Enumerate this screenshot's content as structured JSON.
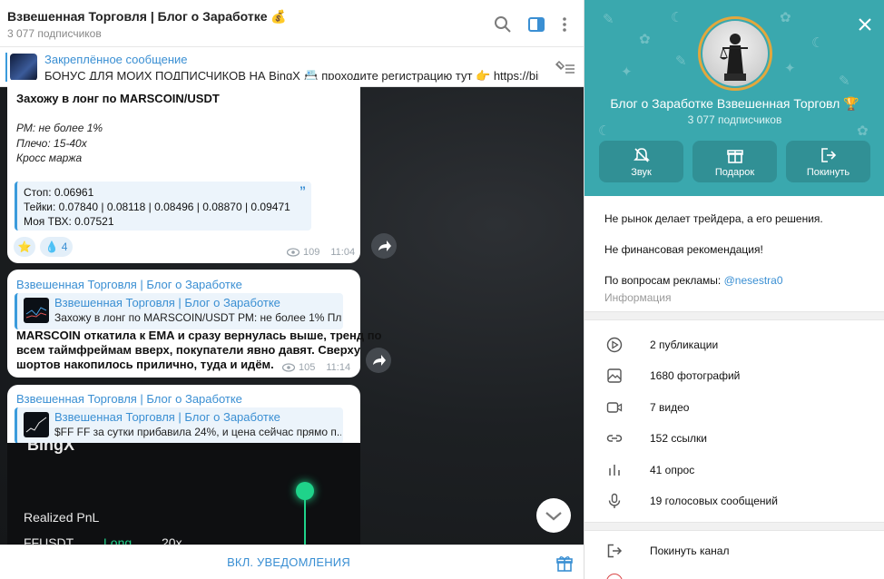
{
  "chat": {
    "title": "Взвешенная Торговля | Блог о Заработке",
    "title_emoji": "💰",
    "subscribers": "3 077 подписчиков",
    "pinned": {
      "title": "Закреплённое сообщение",
      "text": "БОНУС ДЛЯ МОИХ ПОДПИСЧИКОВ НА BingX 📇 проходите регистрацию тут 👉 https://bingx..."
    },
    "messages": [
      {
        "headline": "Захожу в лонг по MARSCOIN/USDT",
        "lines": [
          "РМ: не более 1%",
          "Плечо: 15-40x",
          "Кросс маржа"
        ],
        "quote": [
          "Стоп: 0.06961",
          "Тейки: 0.07840 | 0.08118 | 0.08496 | 0.08870 | 0.09471",
          "Моя ТВХ: 0.07521"
        ],
        "reactions": [
          {
            "emoji": "⭐",
            "count": ""
          },
          {
            "emoji": "💧",
            "count": "4"
          }
        ],
        "views": "109",
        "time": "11:04"
      },
      {
        "sender": "Взвешенная Торговля | Блог о Заработке",
        "fwd_title": "Взвешенная Торговля | Блог о Заработке",
        "fwd_text": "Захожу в лонг по MARSCOIN/USDT  РМ: не более 1% Пле...",
        "body": [
          "MARSCOIN откатила к EMA и сразу вернулась выше, тренд по",
          "всем таймфреймам вверх, покупатели явно давят. Сверху",
          "шортов накопилось прилично, туда и идём."
        ],
        "views": "105",
        "time": "11:14"
      },
      {
        "sender": "Взвешенная Торговля | Блог о Заработке",
        "fwd_title": "Взвешенная Торговля | Блог о Заработке",
        "fwd_text": "$FF  FF за сутки прибавила 24%, и цена сейчас прямо п..."
      }
    ],
    "promo": {
      "logo": "BingX",
      "pnl": "Realized PnL",
      "pair": "FFUSDT",
      "side": "Long",
      "leverage": "20x"
    },
    "footer": {
      "notify": "ВКЛ. УВЕДОМЛЕНИЯ"
    }
  },
  "info": {
    "name": "Блог о Заработке     Взвешенная Торговл",
    "name_emoji": "🏆",
    "subscribers": "3 077 подписчиков",
    "actions": [
      {
        "label": "Звук",
        "icon": "mute-icon"
      },
      {
        "label": "Подарок",
        "icon": "gift-icon"
      },
      {
        "label": "Покинуть",
        "icon": "leave-icon"
      }
    ],
    "description": [
      "Не рынок делает трейдера, а его решения.",
      "Не финансовая рекомендация!"
    ],
    "ads_prefix": "По вопросам рекламы: ",
    "ads_contact": "@nesestra0",
    "info_label": "Информация",
    "stats": [
      {
        "icon": "play-icon",
        "label": "2 публикации"
      },
      {
        "icon": "photo-icon",
        "label": "1680 фотографий"
      },
      {
        "icon": "video-icon",
        "label": "7 видео"
      },
      {
        "icon": "link-icon",
        "label": "152 ссылки"
      },
      {
        "icon": "poll-icon",
        "label": "41 опрос"
      },
      {
        "icon": "mic-icon",
        "label": "19 голосовых сообщений"
      }
    ],
    "leave": "Покинуть канал",
    "accent_color": "#3aa8ae",
    "link_color": "#3a8fd3"
  }
}
